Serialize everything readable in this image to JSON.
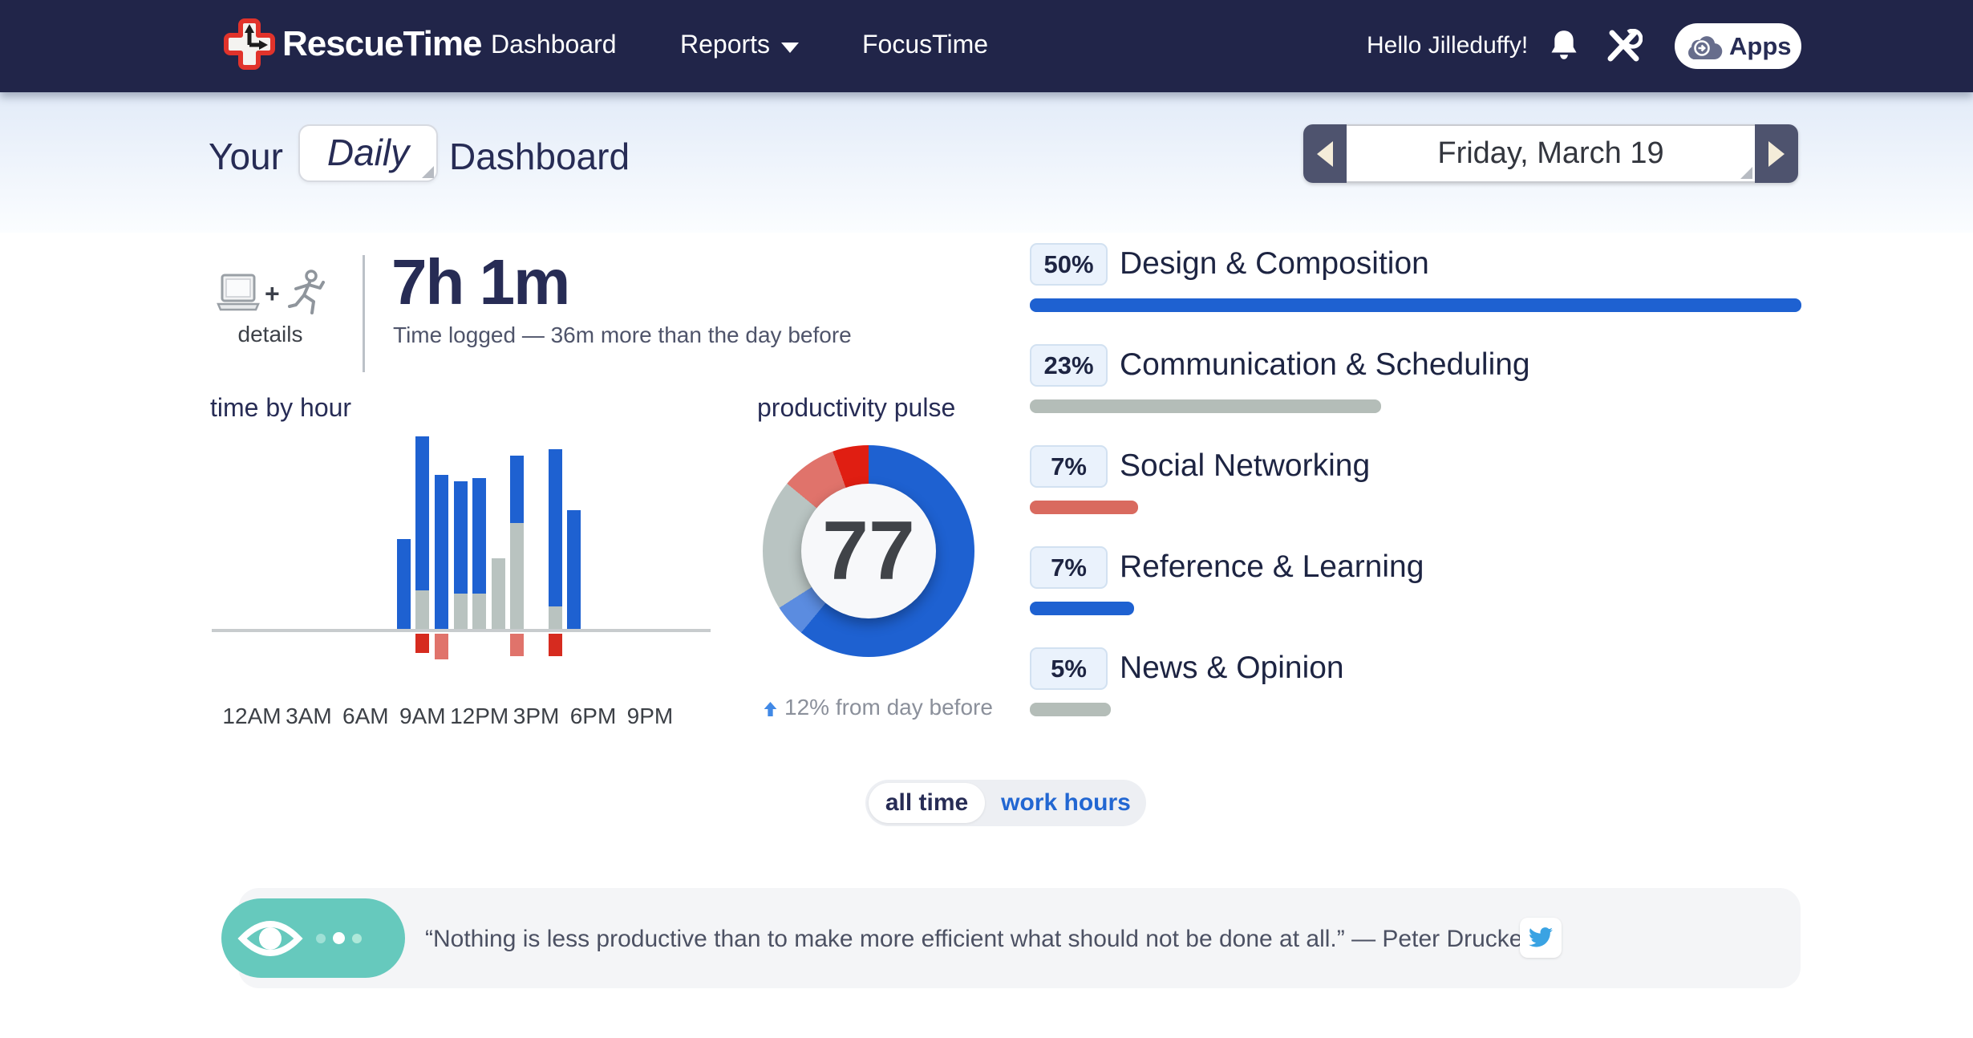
{
  "colors": {
    "productive": "#1e61d1",
    "productive_light": "#5b8ce0",
    "neutral": "#b9c3c0",
    "distracting": "#e0736b",
    "very_distracting": "#d62b1f"
  },
  "nav": {
    "brand": "RescueTime",
    "items": [
      {
        "label": "Dashboard"
      },
      {
        "label": "Reports"
      },
      {
        "label": "FocusTime"
      }
    ],
    "greeting": "Hello Jilleduffy!",
    "apps_label": "Apps"
  },
  "header": {
    "title_prefix": "Your",
    "view_selector": "Daily",
    "title_suffix": "Dashboard",
    "date_label": "Friday, March 19"
  },
  "summary": {
    "details_label": "details",
    "plus": "+",
    "time_logged": "7h 1m",
    "time_note": "Time logged — 36m more than the day before"
  },
  "chart_data": [
    {
      "type": "bar",
      "title": "time by hour",
      "stacked": true,
      "unit": "minutes",
      "ymax": 60,
      "x_labels": [
        "12AM",
        "3AM",
        "6AM",
        "9AM",
        "12PM",
        "3PM",
        "6PM",
        "9PM"
      ],
      "series_names": [
        "productive",
        "neutral",
        "distracting",
        "very_distracting"
      ],
      "bars": [
        {
          "hour": "8AM",
          "hour_index": 8,
          "productive": 28,
          "neutral": 0,
          "distracting": 0,
          "very_distracting": 0
        },
        {
          "hour": "9AM",
          "hour_index": 9,
          "productive": 48,
          "neutral": 12,
          "distracting": 0,
          "very_distracting": 6
        },
        {
          "hour": "10AM",
          "hour_index": 10,
          "productive": 48,
          "neutral": 0,
          "distracting": 8,
          "very_distracting": 0
        },
        {
          "hour": "11AM",
          "hour_index": 11,
          "productive": 35,
          "neutral": 11,
          "distracting": 0,
          "very_distracting": 0
        },
        {
          "hour": "12PM",
          "hour_index": 12,
          "productive": 36,
          "neutral": 11,
          "distracting": 0,
          "very_distracting": 0
        },
        {
          "hour": "1PM",
          "hour_index": 13,
          "productive": 0,
          "neutral": 22,
          "distracting": 0,
          "very_distracting": 0
        },
        {
          "hour": "2PM",
          "hour_index": 14,
          "productive": 21,
          "neutral": 33,
          "distracting": 7,
          "very_distracting": 0
        },
        {
          "hour": "4PM",
          "hour_index": 16,
          "productive": 49,
          "neutral": 7,
          "distracting": 0,
          "very_distracting": 7
        },
        {
          "hour": "5PM",
          "hour_index": 17,
          "productive": 37,
          "neutral": 0,
          "distracting": 0,
          "very_distracting": 0
        }
      ]
    },
    {
      "type": "donut",
      "title": "productivity pulse",
      "value": "77",
      "note": "12% from day before",
      "segments": [
        {
          "name": "very_productive",
          "pct": 61,
          "color": "#1e61d1"
        },
        {
          "name": "productive",
          "pct": 5,
          "color": "#5b8ce0"
        },
        {
          "name": "neutral",
          "pct": 20,
          "color": "#b9c4c2"
        },
        {
          "name": "distracting",
          "pct": 8.5,
          "color": "#e0736b"
        },
        {
          "name": "very_distracting",
          "pct": 5.5,
          "color": "#e01e12"
        }
      ]
    }
  ],
  "categories": {
    "rows": [
      {
        "pct": "50%",
        "label": "Design & Composition",
        "bar_width_pct": 100,
        "color": "#1e61d1"
      },
      {
        "pct": "23%",
        "label": "Communication & Scheduling",
        "bar_width_pct": 45.5,
        "color": "#b4bdb8"
      },
      {
        "pct": "7%",
        "label": "Social Networking",
        "bar_width_pct": 14,
        "color": "#d96a5f"
      },
      {
        "pct": "7%",
        "label": "Reference & Learning",
        "bar_width_pct": 13.5,
        "color": "#1e61d1"
      },
      {
        "pct": "5%",
        "label": "News & Opinion",
        "bar_width_pct": 10.5,
        "color": "#b4bdb8"
      }
    ]
  },
  "toggle": {
    "active": "all time",
    "inactive": "work hours"
  },
  "quote": {
    "text": "“Nothing is less productive than to make more efficient what should not be done at all.” — Peter Drucker"
  }
}
